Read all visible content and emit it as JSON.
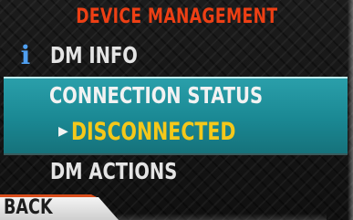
{
  "header": {
    "title": "DEVICE MANAGEMENT"
  },
  "menu": {
    "items": [
      {
        "label": "DM INFO",
        "icon": "info-icon"
      },
      {
        "label": "CONNECTION STATUS",
        "value": "DISCONNECTED",
        "selected": true
      },
      {
        "label": "DM ACTIONS"
      }
    ]
  },
  "footer": {
    "back_label": "BACK"
  },
  "colors": {
    "title": "#ee3f14",
    "selection": "#1a8893",
    "status_value": "#f5c81a",
    "info_icon": "#4f9ff0",
    "back_tab": "#e9e9e9"
  }
}
